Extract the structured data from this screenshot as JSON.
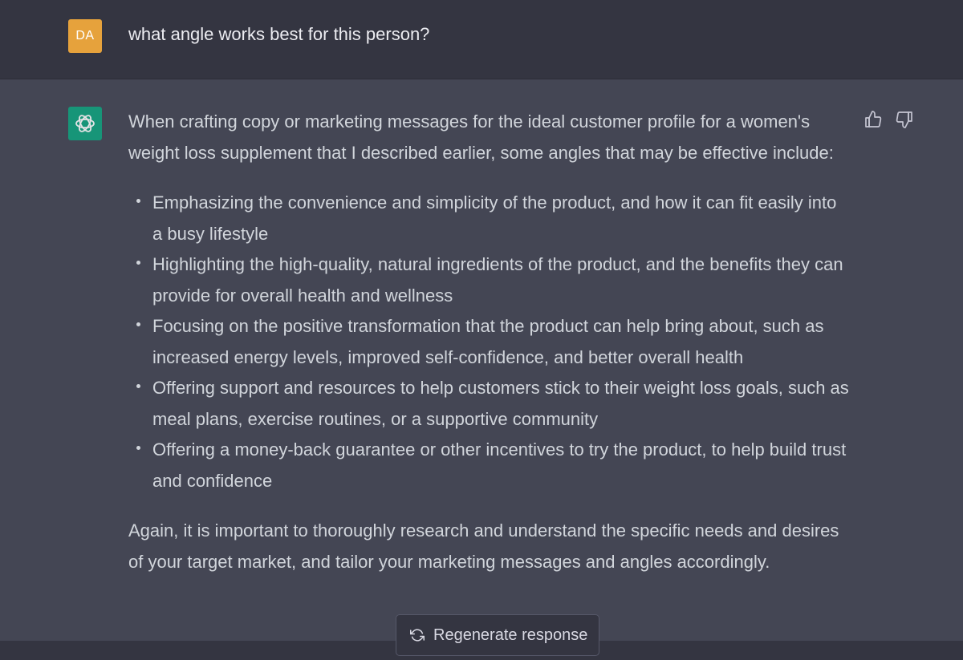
{
  "user_message": {
    "avatar_initials": "DA",
    "avatar_color": "#e6a23c",
    "text": "what angle works best for this person?"
  },
  "assistant_message": {
    "avatar_icon": "openai-logo-icon",
    "avatar_color": "#10a37f",
    "intro": "When crafting copy or marketing messages for the ideal customer profile for a women's weight loss supplement that I described earlier, some angles that may be effective include:",
    "bullets": [
      "Emphasizing the convenience and simplicity of the product, and how it can fit easily into a busy lifestyle",
      "Highlighting the high-quality, natural ingredients of the product, and the benefits they can provide for overall health and wellness",
      "Focusing on the positive transformation that the product can help bring about, such as increased energy levels, improved self-confidence, and better overall health",
      "Offering support and resources to help customers stick to their weight loss goals, such as meal plans, exercise routines, or a supportive community",
      "Offering a money-back guarantee or other incentives to try the product, to help build trust and confidence"
    ],
    "conclusion": "Again, it is important to thoroughly research and understand the specific needs and desires of your target market, and tailor your marketing messages and angles accordingly."
  },
  "feedback": {
    "thumbs_up_icon": "thumbs-up-icon",
    "thumbs_down_icon": "thumbs-down-icon"
  },
  "regenerate": {
    "icon": "refresh-icon",
    "label": "Regenerate response"
  },
  "colors": {
    "user_row_bg": "#343541",
    "assistant_row_bg": "#444654",
    "text": "#d1d5db"
  }
}
